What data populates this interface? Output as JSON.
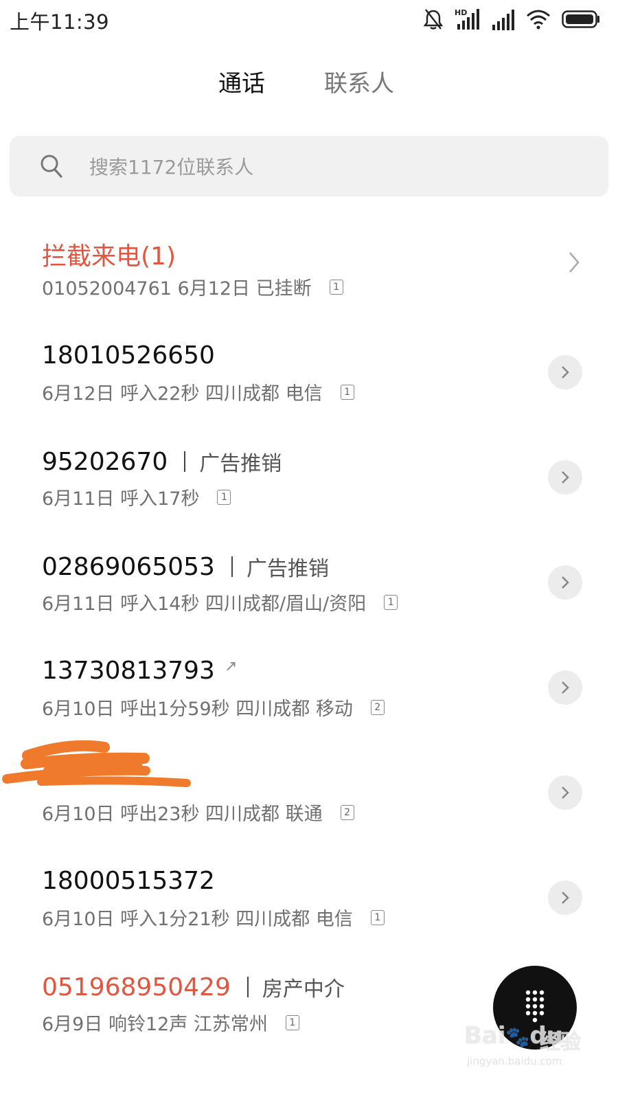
{
  "status_bar": {
    "time": "上午11:39",
    "icons": [
      "mute-bell-icon",
      "hd-signal-icon",
      "signal-icon",
      "wifi-icon",
      "battery-icon"
    ],
    "hd_label": "HD"
  },
  "tabs": [
    {
      "label": "通话",
      "active": true
    },
    {
      "label": "联系人",
      "active": false
    }
  ],
  "search": {
    "placeholder": "搜索1172位联系人",
    "icon": "search-icon"
  },
  "calls": [
    {
      "title": "拦截来电(1)",
      "subtitle": "01052004761 6月12日 已挂断",
      "sim": "1",
      "title_color": "#e2553f"
    },
    {
      "title": "18010526650",
      "subtitle": "6月12日 呼入22秒 四川成都 电信",
      "sim": "1"
    },
    {
      "title": "95202670",
      "tag": "广告推销",
      "subtitle": "6月11日 呼入17秒",
      "sim": "1"
    },
    {
      "title": "02869065053",
      "tag": "广告推销",
      "subtitle": "6月11日 呼入14秒 四川成都/眉山/资阳",
      "sim": "1"
    },
    {
      "title": "13730813793",
      "subtitle": "6月10日 呼出1分59秒 四川成都 移动",
      "sim": "2",
      "outgoing_icon": "outgoing-arrow-icon",
      "outgoing_glyph": "↗"
    },
    {
      "subtitle": "6月10日 呼出23秒 四川成都 联通",
      "sim": "2",
      "redacted": true
    },
    {
      "title": "18000515372",
      "subtitle": "6月10日 呼入1分21秒 四川成都 电信",
      "sim": "1"
    },
    {
      "title": "051968950429",
      "tag": "房产中介",
      "subtitle": "6月9日 响铃12声 江苏常州",
      "sim": "1",
      "title_color": "#e2553f"
    }
  ],
  "fab": {
    "icon": "dialpad-icon"
  },
  "watermark": {
    "brand": "Bai",
    "brand2": "du",
    "cn": "经验",
    "url": "jingyan.baidu.com"
  },
  "colors": {
    "accent_red": "#e2553f",
    "redaction": "#f07a2c",
    "fab_bg": "#111111"
  }
}
